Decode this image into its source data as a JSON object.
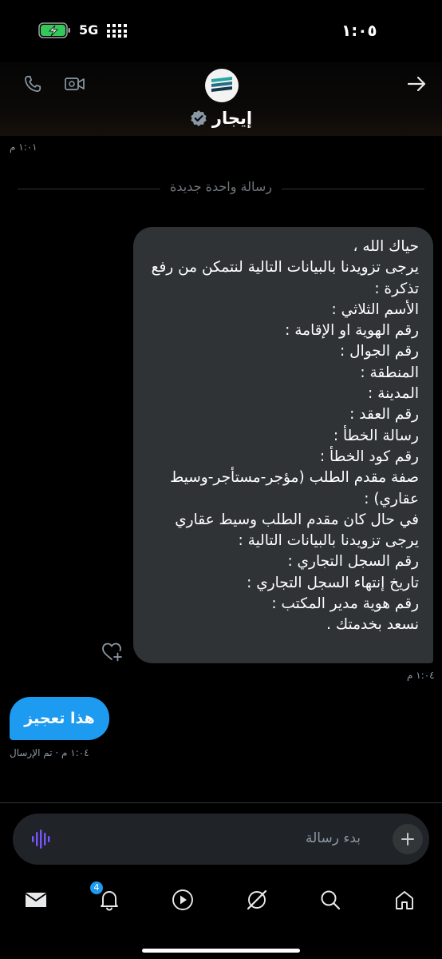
{
  "status_bar": {
    "time": "١:٠٥",
    "network": "5G"
  },
  "header": {
    "title": "إيجار",
    "verified": true
  },
  "messages": {
    "earlier_time": "١:٠١ م",
    "divider_label": "رسالة واحدة جديدة",
    "incoming": {
      "text": "حياك الله ،\nيرجى تزويدنا بالبيانات التالية لنتمكن من رفع تذكرة :\nالأسم الثلاثي :\nرقم الهوية او الإقامة :\nرقم الجوال :\nالمنطقة :\nالمدينة :\nرقم العقد :\nرسالة الخطأ :\nرقم كود الخطأ :\nصفة مقدم الطلب (مؤجر-مستأجر-وسيط عقاري) :\nفي حال كان مقدم الطلب وسيط عقاري\nيرجى تزويدنا بالبيانات التالية :\nرقم السجل التجاري :\nتاريخ إنتهاء السجل التجاري :\nرقم هوية مدير المكتب :\nنسعد بخدمتك .",
      "time": "١:٠٤ م"
    },
    "outgoing": {
      "text": "هذا تعجيز",
      "status": "١:٠٤ م · تم الإرسال"
    }
  },
  "composer": {
    "placeholder": "بدء رسالة"
  },
  "tabbar": {
    "notifications_badge": "4"
  },
  "colors": {
    "accent": "#1d9bf0",
    "bubble_in": "#2f3336",
    "voice": "#7856ff"
  }
}
